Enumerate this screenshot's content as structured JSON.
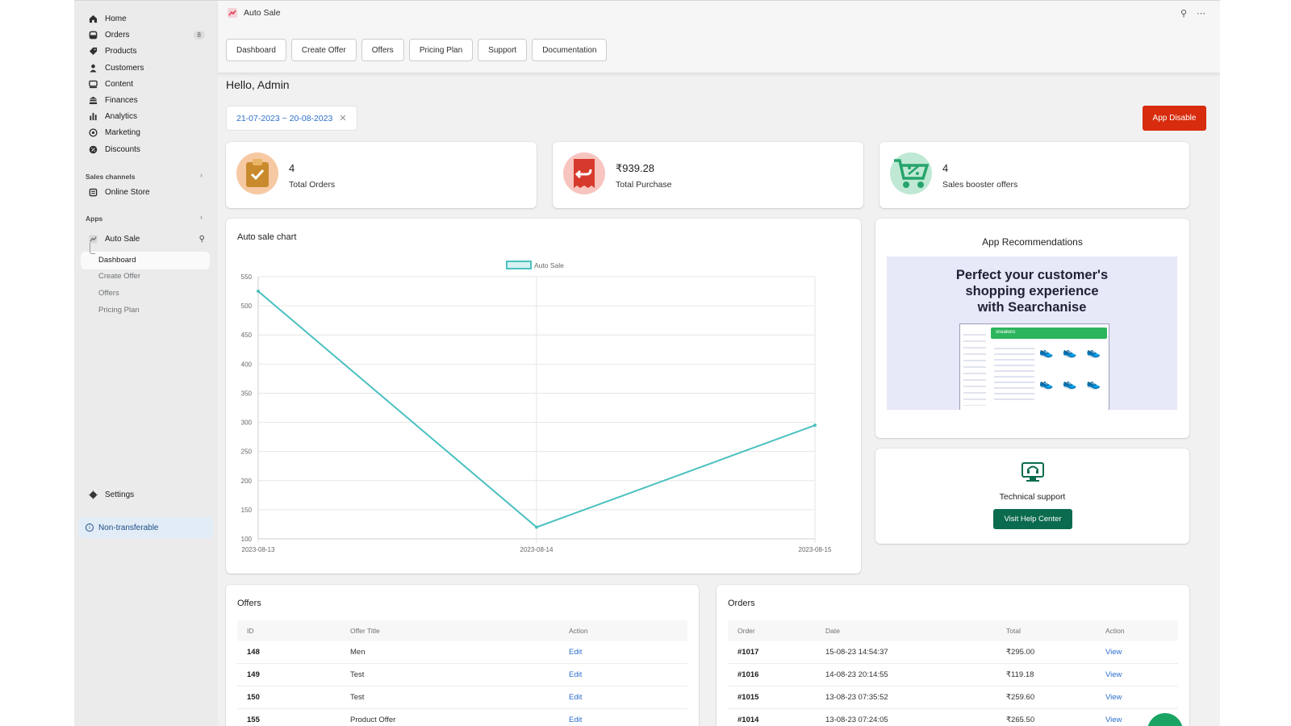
{
  "sidebar": {
    "items": [
      {
        "label": "Home",
        "icon": "home-icon"
      },
      {
        "label": "Orders",
        "icon": "orders-icon",
        "badge": "8"
      },
      {
        "label": "Products",
        "icon": "tag-icon"
      },
      {
        "label": "Customers",
        "icon": "person-icon"
      },
      {
        "label": "Content",
        "icon": "content-icon"
      },
      {
        "label": "Finances",
        "icon": "bank-icon"
      },
      {
        "label": "Analytics",
        "icon": "bar-chart-icon"
      },
      {
        "label": "Marketing",
        "icon": "target-icon"
      },
      {
        "label": "Discounts",
        "icon": "discount-icon"
      }
    ],
    "sales_channels_title": "Sales channels",
    "online_store": "Online Store",
    "apps_title": "Apps",
    "app_name": "Auto Sale",
    "app_sub": [
      "Dashboard",
      "Create Offer",
      "Offers",
      "Pricing Plan"
    ],
    "settings": "Settings",
    "non_transferable": "Non-transferable"
  },
  "header": {
    "app_title": "Auto Sale",
    "tabs": [
      "Dashboard",
      "Create Offer",
      "Offers",
      "Pricing Plan",
      "Support",
      "Documentation"
    ]
  },
  "greeting": "Hello, Admin",
  "date_range": "21-07-2023 ~ 20-08-2023",
  "app_disable_label": "App Disable",
  "stats": [
    {
      "value": "4",
      "label": "Total Orders",
      "color": "#f6c9a3"
    },
    {
      "value": "₹939.28",
      "label": "Total Purchase",
      "color": "#f8c4c0"
    },
    {
      "value": "4",
      "label": "Sales booster offers",
      "color": "#bfe9d4"
    }
  ],
  "chart": {
    "title": "Auto sale chart",
    "color": "#4bc0c0"
  },
  "chart_data": {
    "type": "line",
    "x": [
      "2023-08-13",
      "2023-08-14",
      "2023-08-15"
    ],
    "series": [
      {
        "name": "Auto Sale",
        "values": [
          525,
          120,
          295
        ]
      }
    ],
    "ylim": [
      100,
      550
    ],
    "yticks": [
      100,
      150,
      200,
      250,
      300,
      350,
      400,
      450,
      500,
      550
    ],
    "grid": true,
    "legend": "top-center"
  },
  "recommendations": {
    "title": "App Recommendations",
    "headline": [
      "Perfect your customer's",
      "shopping experience",
      "with Searchanise"
    ],
    "search_text": "sneakers"
  },
  "support": {
    "title": "Technical support",
    "button": "Visit Help Center"
  },
  "offers": {
    "title": "Offers",
    "columns": [
      "ID",
      "Offer Title",
      "Action"
    ],
    "rows": [
      {
        "id": "148",
        "title": "Men",
        "action": "Edit"
      },
      {
        "id": "149",
        "title": "Test",
        "action": "Edit"
      },
      {
        "id": "150",
        "title": "Test",
        "action": "Edit"
      },
      {
        "id": "155",
        "title": "Product Offer",
        "action": "Edit"
      }
    ]
  },
  "orders": {
    "title": "Orders",
    "columns": [
      "Order",
      "Date",
      "Total",
      "Action"
    ],
    "rows": [
      {
        "order": "#1017",
        "date": "15-08-23 14:54:37",
        "total": "₹295.00",
        "action": "View"
      },
      {
        "order": "#1016",
        "date": "14-08-23 20:14:55",
        "total": "₹119.18",
        "action": "View"
      },
      {
        "order": "#1015",
        "date": "13-08-23 07:35:52",
        "total": "₹259.60",
        "action": "View"
      },
      {
        "order": "#1014",
        "date": "13-08-23 07:24:05",
        "total": "₹265.50",
        "action": "View"
      }
    ]
  }
}
